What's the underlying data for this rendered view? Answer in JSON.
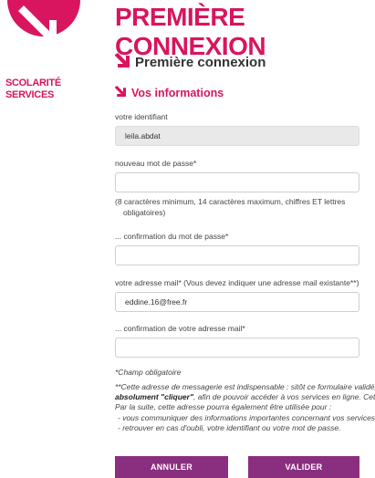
{
  "header": {
    "title": "PREMIÈRE CONNEXION",
    "logo_line1": "Scolarité",
    "logo_line2": "Services"
  },
  "page_subtitle": "Première connexion",
  "section_title": "Vos informations",
  "form": {
    "identifiant_label": "votre identifiant",
    "identifiant_value": "leila.abdat",
    "password_label": "nouveau mot de passe*",
    "password_value": "",
    "password_hint_1": "(8 caractères minimum, 14 caractères maximum, chiffres ET lettres",
    "password_hint_2": "obligatoires)",
    "password_confirm_label": "... confirmation du mot de passe*",
    "password_confirm_value": "",
    "email_label": "votre adresse mail* (Vous devez indiquer une adresse mail existante**)",
    "email_value": "eddine.16@free.fr",
    "email_confirm_label": "... confirmation de votre adresse mail*",
    "email_confirm_value": ""
  },
  "required_note": "*Champ obligatoire",
  "notice": {
    "line1": "**Cette adresse de messagerie est indispensable : sitôt ce formulaire validé,",
    "line2_bold": "absolument \"cliquer\"",
    "line2_rest": ", afin de pouvoir accéder à vos services en ligne. Cette op",
    "line3": "Par la suite, cette adresse pourra également être utilisée pour :",
    "line4": "- vous communiquer des informations importantes concernant vos services",
    "line5": "- retrouver en cas d'oubli, votre identifiant ou votre mot de passe."
  },
  "buttons": {
    "cancel": "ANNULER",
    "validate": "VALIDER"
  },
  "colors": {
    "brand_pink": "#d8155e",
    "button_purple": "#8a2e7f"
  }
}
